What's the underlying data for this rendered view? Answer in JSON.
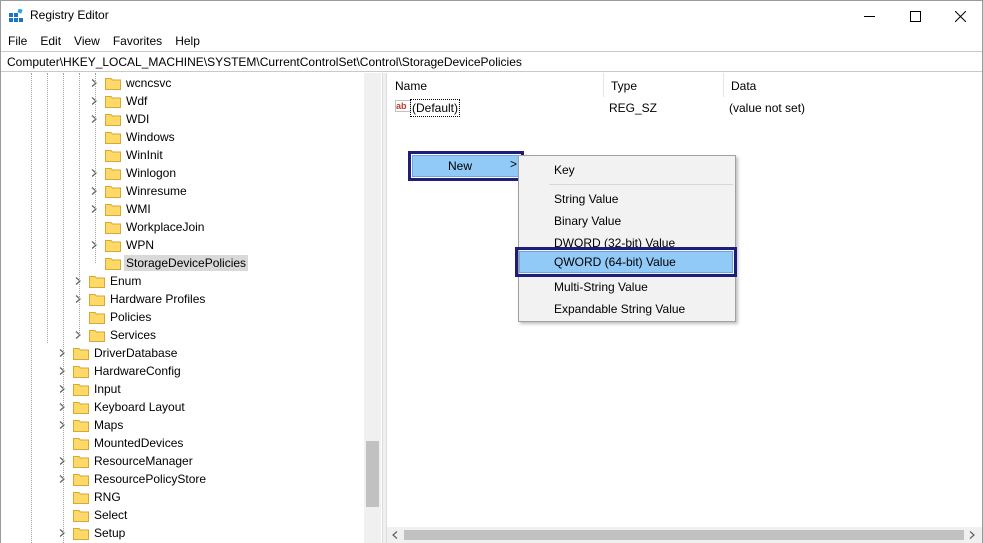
{
  "window": {
    "title": "Registry Editor"
  },
  "menu": [
    "File",
    "Edit",
    "View",
    "Favorites",
    "Help"
  ],
  "address": "Computer\\HKEY_LOCAL_MACHINE\\SYSTEM\\CurrentControlSet\\Control\\StorageDevicePolicies",
  "tree": {
    "level2": [
      "wcncsvc",
      "Wdf",
      "WDI",
      "Windows",
      "WinInit",
      "Winlogon",
      "Winresume",
      "WMI",
      "WorkplaceJoin",
      "WPN",
      "StorageDevicePolicies"
    ],
    "level1": [
      "Enum",
      "Hardware Profiles",
      "Policies",
      "Services"
    ],
    "level0": [
      "DriverDatabase",
      "HardwareConfig",
      "Input",
      "Keyboard Layout",
      "Maps",
      "MountedDevices",
      "ResourceManager",
      "ResourcePolicyStore",
      "RNG",
      "Select",
      "Setup"
    ],
    "selected": "StorageDevicePolicies"
  },
  "list": {
    "headers": {
      "name": "Name",
      "type": "Type",
      "data": "Data"
    },
    "rows": [
      {
        "name": "(Default)",
        "type": "REG_SZ",
        "data": "(value not set)"
      }
    ]
  },
  "context_menu": {
    "new_label": "New",
    "new_arrow": ">",
    "submenu": [
      "Key",
      "String Value",
      "Binary Value",
      "DWORD (32-bit) Value",
      "QWORD (64-bit) Value",
      "Multi-String Value",
      "Expandable String Value"
    ],
    "highlighted": "QWORD (64-bit) Value"
  },
  "colors": {
    "highlight": "#91c9f7",
    "callout_border": "#1f1c7a",
    "folder": "#ffd966"
  }
}
